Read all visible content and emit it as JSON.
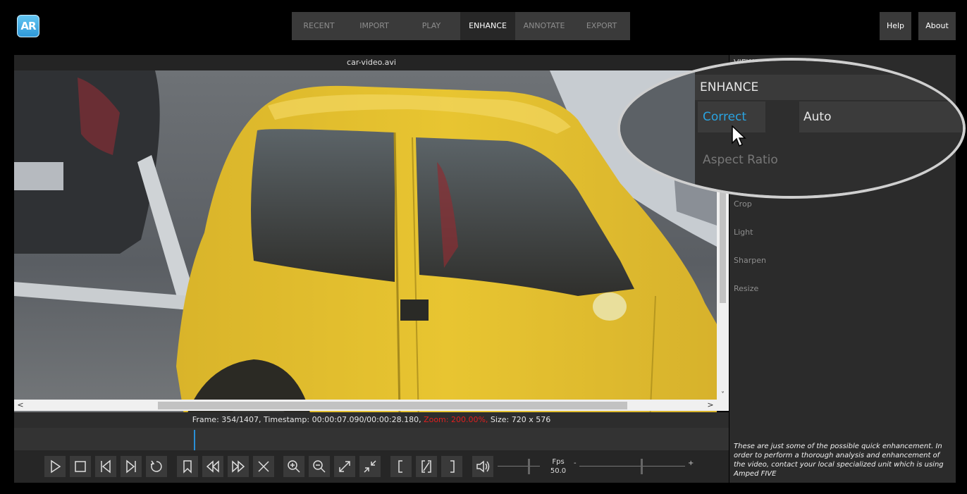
{
  "app": {
    "logo_text": "AR",
    "logo_colors": [
      "#63c6f2",
      "#2f98d8"
    ]
  },
  "topnav": {
    "tabs": [
      {
        "label": "RECENT",
        "active": false
      },
      {
        "label": "IMPORT",
        "active": false
      },
      {
        "label": "PLAY",
        "active": false
      },
      {
        "label": "ENHANCE",
        "active": true
      },
      {
        "label": "ANNOTATE",
        "active": false
      },
      {
        "label": "EXPORT",
        "active": false
      }
    ],
    "help_label": "Help",
    "about_label": "About"
  },
  "viewer": {
    "filename": "car-video.avi",
    "scroll_down_arrow": "˅",
    "scroll_left_arrow": "<",
    "scroll_right_arrow": ">"
  },
  "status": {
    "frame_text": "Frame: 354/1407, Timestamp: 00:00:07.090/00:00:28.180,",
    "zoom_text": "Zoom: 200.00%,",
    "size_text": "Size: 720 x 576",
    "zoom_color": "#e01f1f"
  },
  "timeline": {
    "position_fraction": 0.2516,
    "cursor_color": "#2a8fd6"
  },
  "controls": {
    "buttons": [
      "play-icon",
      "stop-icon",
      "previous-frame-icon",
      "next-frame-icon",
      "loop-icon",
      "bookmark-icon",
      "rewind-icon",
      "fast-forward-icon",
      "close-icon",
      "zoom-in-icon",
      "zoom-out-icon",
      "fit-to-window-icon",
      "actual-size-icon",
      "mark-in-icon",
      "mark-range-icon",
      "mark-out-icon",
      "volume-icon"
    ],
    "fps_label": "Fps",
    "fps_value": "50.0",
    "minus_label": "-",
    "plus_label": "+"
  },
  "panel": {
    "view_label": "VIEW",
    "items": [
      "Crop",
      "Light",
      "Sharpen",
      "Resize"
    ],
    "note": "These are just some of the possible quick enhancement. In order to perform a thorough analysis and enhancement of the video, contact your local specialized unit which is using Amped FIVE"
  },
  "magnifier": {
    "header": "ENHANCE",
    "correct_label": "Correct",
    "auto_label": "Auto",
    "aspect_label": "Aspect Ratio",
    "accent_color": "#2aa3e0"
  }
}
